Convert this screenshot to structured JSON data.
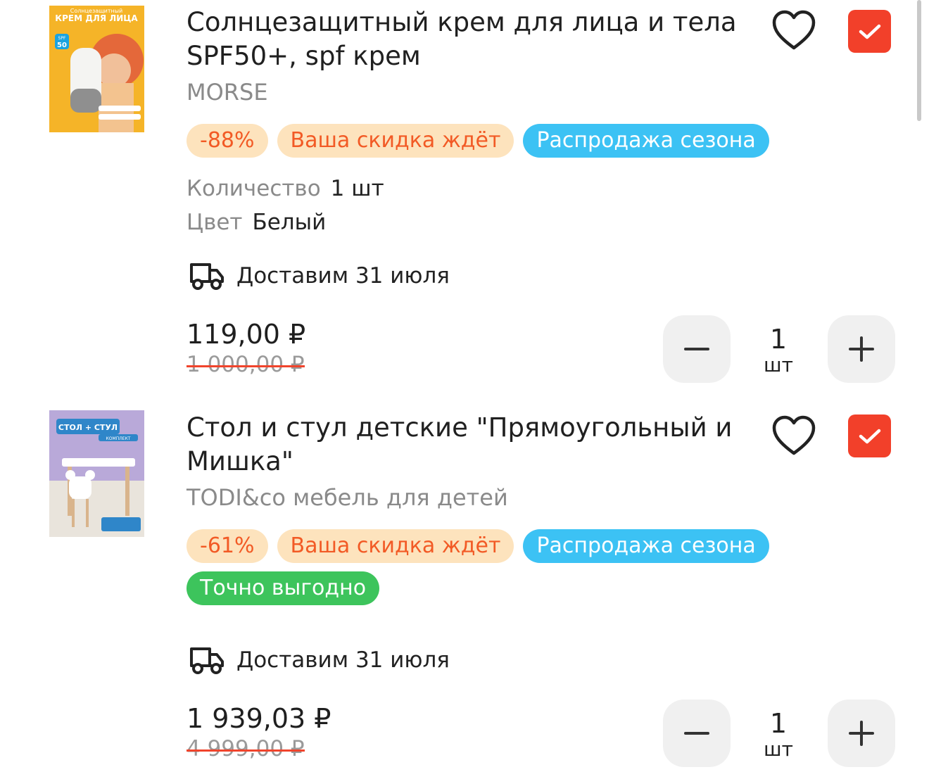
{
  "items": [
    {
      "title": "Солнцезащитный крем для лица и тела SPF50+, spf крем",
      "brand": "MORSE",
      "badges": [
        "-88%",
        "Ваша скидка ждёт",
        "Распродажа сезона"
      ],
      "attributes": [
        {
          "key": "Количество",
          "value": "1 шт"
        },
        {
          "key": "Цвет",
          "value": "Белый"
        }
      ],
      "delivery": "Доставим 31 июля",
      "price": "119,00 ₽",
      "old_price": "1 000,00 ₽",
      "qty": "1",
      "qty_unit": "шт",
      "thumb": {
        "small": "Солнцезащитный",
        "headline": "КРЕМ ДЛЯ ЛИЦА",
        "spf_label": "SPF",
        "spf": "50"
      }
    },
    {
      "title": "Стол и стул детские \"Прямоугольный и Мишка\"",
      "brand": "TODI&co мебель для детей",
      "badges": [
        "-61%",
        "Ваша скидка ждёт",
        "Распродажа сезона",
        "Точно выгодно"
      ],
      "delivery": "Доставим 31 июля",
      "price": "1 939,03 ₽",
      "old_price": "4 999,00 ₽",
      "qty": "1",
      "qty_unit": "шт",
      "thumb": {
        "headline": "СТОЛ + СТУЛ",
        "sub": "КОМПЛЕКТ"
      }
    }
  ],
  "colors": {
    "accent_red": "#f2402a",
    "badge_orange_bg": "#fde3bd",
    "badge_orange_text": "#f25a25",
    "badge_blue": "#3cc2f4",
    "badge_green": "#3dc45c"
  },
  "icons": [
    "truck-icon",
    "heart-icon",
    "checkbox-checked-icon",
    "minus-icon",
    "plus-icon"
  ]
}
